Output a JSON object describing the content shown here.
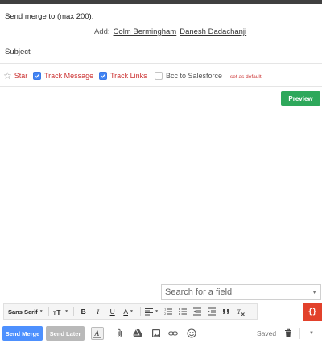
{
  "recipients": {
    "to_label": "Send merge to (max 200):",
    "add_label": "Add:",
    "suggestions": [
      "Colm Bermingham",
      "Danesh Dadachanji"
    ]
  },
  "subject": {
    "placeholder": "Subject"
  },
  "options": {
    "star_label": "Star",
    "track_message_label": "Track Message",
    "track_message_checked": true,
    "track_links_label": "Track Links",
    "track_links_checked": true,
    "bcc_label": "Bcc to Salesforce",
    "bcc_checked": false,
    "set_default_label": "set as default"
  },
  "preview_label": "Preview",
  "field_search": {
    "placeholder": "Search for a field"
  },
  "format_bar": {
    "font_family": "Sans Serif",
    "size_icon": "text-size-icon",
    "bold": "B",
    "italic": "I",
    "underline": "U",
    "text_color": "A"
  },
  "braces_label": "{}",
  "bottom_bar": {
    "send_merge_label": "Send Merge",
    "send_later_label": "Send Later",
    "saved_label": "Saved"
  },
  "colors": {
    "accent_blue": "#4d90fe",
    "preview_green": "#2ea85b",
    "braces_red": "#e2412b",
    "option_red": "#cc3333"
  }
}
